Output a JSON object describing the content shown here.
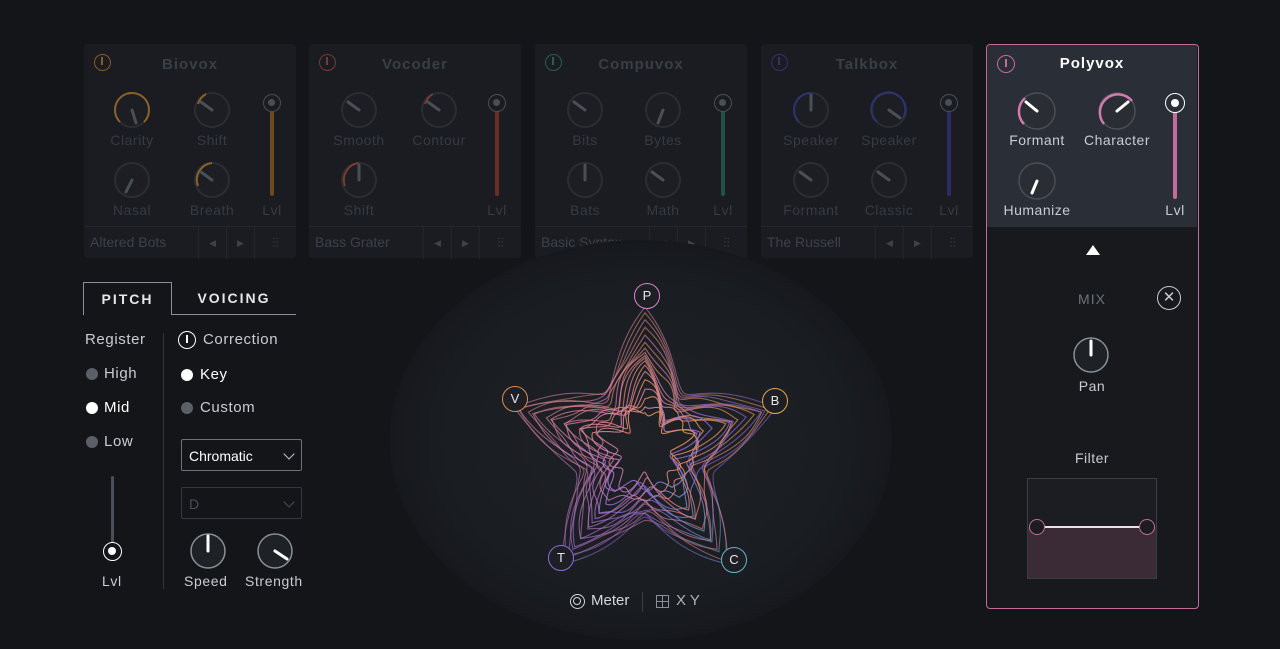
{
  "modules": [
    {
      "name": "Biovox",
      "accent": "#a0702a",
      "knobs": [
        "Clarity",
        "Shift",
        "Nasal",
        "Breath"
      ],
      "level_label": "Lvl",
      "preset": "Altered Bots"
    },
    {
      "name": "Vocoder",
      "accent": "#a04a3a",
      "knobs": [
        "Smooth",
        "Contour",
        "Shift"
      ],
      "level_label": "Lvl",
      "preset": "Bass Grater"
    },
    {
      "name": "Compuvox",
      "accent": "#2f6b62",
      "knobs": [
        "Bits",
        "Bytes",
        "Bats",
        "Math"
      ],
      "level_label": "Lvl",
      "preset": "Basic Syntax"
    },
    {
      "name": "Talkbox",
      "accent": "#3a3f8a",
      "knobs": [
        "Speaker",
        "Speaker",
        "Formant",
        "Classic"
      ],
      "level_label": "Lvl",
      "preset": "The Russell"
    }
  ],
  "polyvox": {
    "name": "Polyvox",
    "accent": "#c46b9c",
    "knobs": [
      "Formant",
      "Character",
      "Humanize"
    ],
    "level_label": "Lvl",
    "mix_label": "MIX",
    "pan_label": "Pan",
    "filter_label": "Filter"
  },
  "left_panel": {
    "tabs": [
      "PITCH",
      "VOICING"
    ],
    "register_label": "Register",
    "register_options": [
      "High",
      "Mid",
      "Low"
    ],
    "register_selected": "Mid",
    "level_label": "Lvl",
    "correction_label": "Correction",
    "correction_options": [
      "Key",
      "Custom"
    ],
    "correction_selected": "Key",
    "scale_value": "Chromatic",
    "key_value": "D",
    "speed_label": "Speed",
    "strength_label": "Strength"
  },
  "visualizer": {
    "vertices": [
      {
        "label": "P",
        "color": "#d982c8"
      },
      {
        "label": "B",
        "color": "#e8a54a"
      },
      {
        "label": "C",
        "color": "#5fb3c9"
      },
      {
        "label": "T",
        "color": "#8b6ad8"
      },
      {
        "label": "V",
        "color": "#e0884a"
      }
    ],
    "meter_label": "Meter",
    "xy_label": "X Y"
  }
}
